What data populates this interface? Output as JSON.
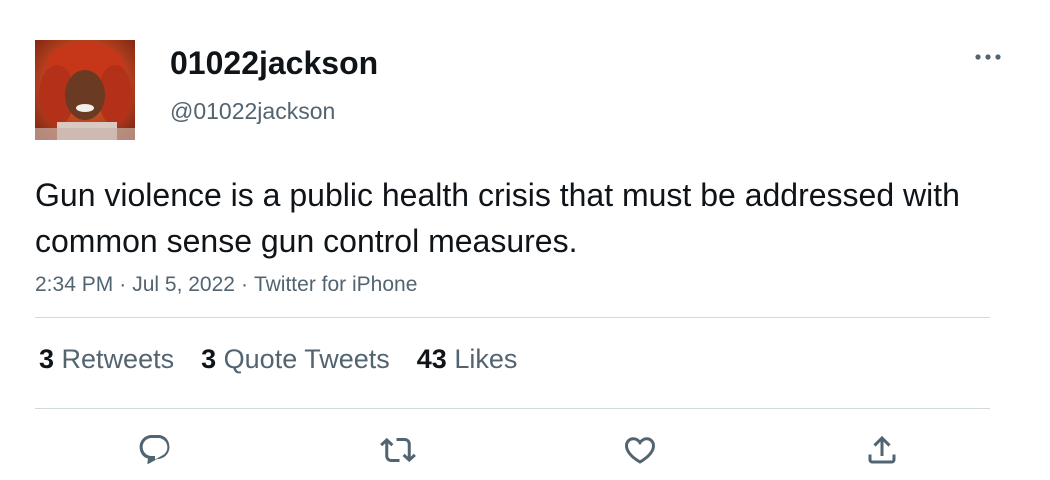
{
  "user": {
    "display_name": "01022jackson",
    "handle": "@01022jackson"
  },
  "tweet": {
    "text": "Gun violence is a public health crisis that must be addressed with common sense gun control measures.",
    "time": "2:34 PM",
    "date": "Jul 5, 2022",
    "source": "Twitter for iPhone",
    "separator": "·"
  },
  "stats": {
    "retweets": {
      "count": "3",
      "label": "Retweets"
    },
    "quotes": {
      "count": "3",
      "label": "Quote Tweets"
    },
    "likes": {
      "count": "43",
      "label": "Likes"
    }
  },
  "icons": {
    "more": "more-horizontal-icon",
    "reply": "reply-icon",
    "retweet": "retweet-icon",
    "like": "heart-icon",
    "share": "share-icon"
  },
  "colors": {
    "text_primary": "#0f1419",
    "text_secondary": "#536471",
    "divider": "#cfd9de"
  }
}
